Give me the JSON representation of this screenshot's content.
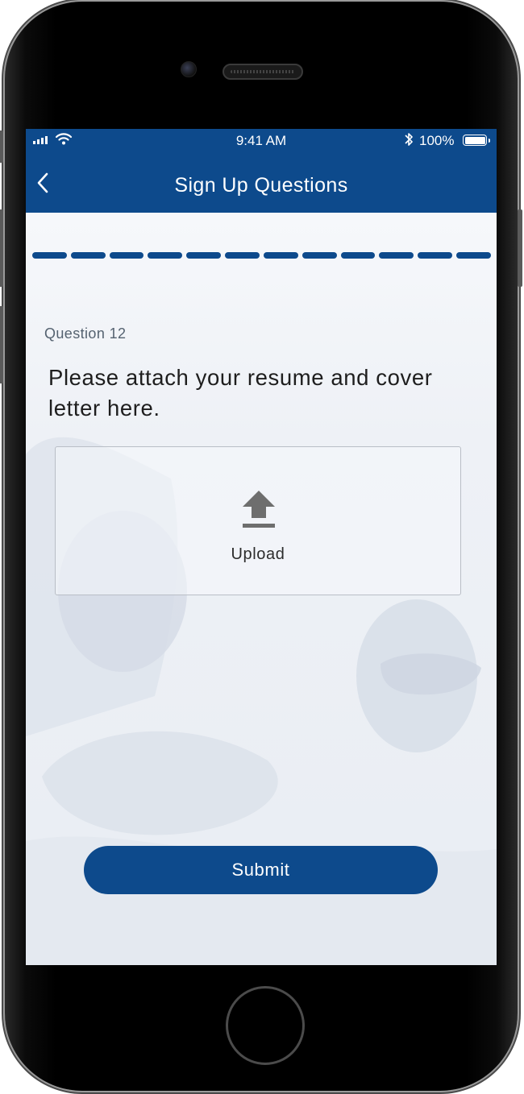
{
  "status_bar": {
    "time": "9:41 AM",
    "battery": "100%"
  },
  "header": {
    "title": "Sign Up Questions"
  },
  "progress": {
    "segments": 12,
    "completed": 12
  },
  "question": {
    "number_label": "Question 12",
    "text": "Please attach your resume and cover letter here."
  },
  "upload": {
    "label": "Upload"
  },
  "submit": {
    "label": "Submit"
  },
  "colors": {
    "brand": "#0d4a8c",
    "background": "#f3f5f9"
  },
  "icons": {
    "back": "chevron-left-icon",
    "upload": "upload-arrow-icon",
    "signal": "cellular-signal-icon",
    "wifi": "wifi-icon",
    "bluetooth": "bluetooth-icon",
    "battery": "battery-icon"
  }
}
